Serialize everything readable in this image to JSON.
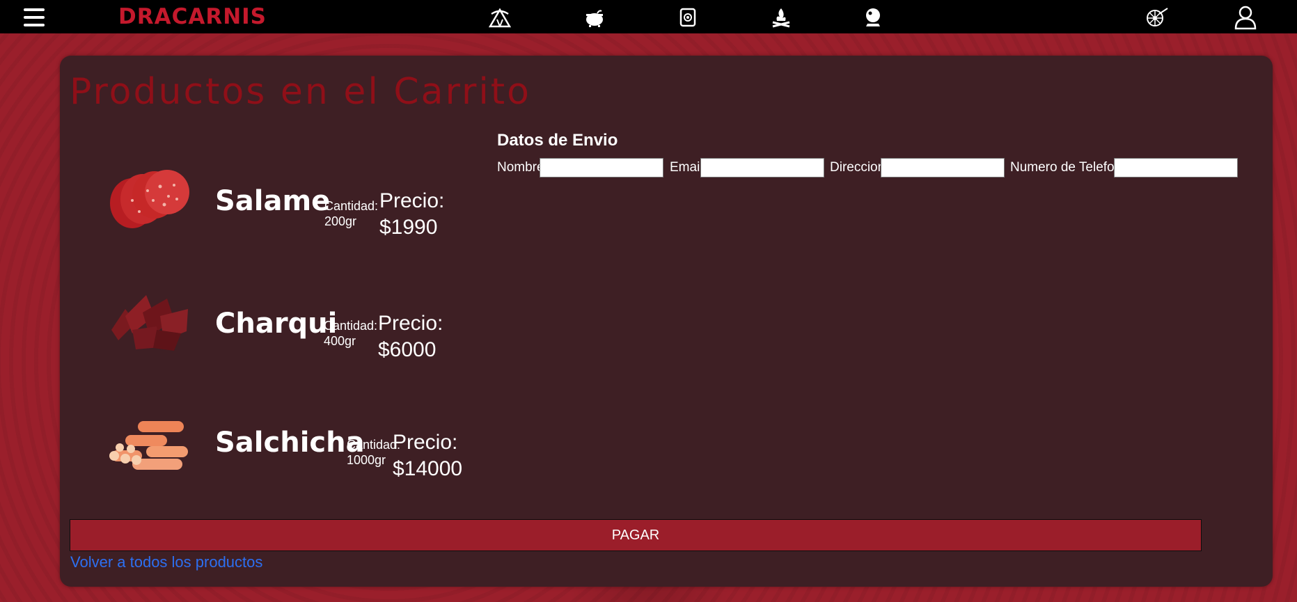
{
  "header": {
    "brand": "DRACARNIS",
    "nav_icons": [
      "tent-icon",
      "cauldron-icon",
      "sack-icon",
      "campfire-icon",
      "crystal-ball-icon",
      "cart-wheel-icon",
      "user-icon"
    ]
  },
  "main": {
    "title": "Productos en el Carrito",
    "products": [
      {
        "name": "Salame",
        "qty_label": "Cantidad:",
        "qty_value": "200gr",
        "price_label": "Precio:",
        "price_value": "$1990",
        "image": "salame-image"
      },
      {
        "name": "Charqui",
        "qty_label": "Cantidad:",
        "qty_value": "400gr",
        "price_label": "Precio:",
        "price_value": "$6000",
        "image": "charqui-image"
      },
      {
        "name": "Salchicha",
        "qty_label": "Cantidad:",
        "qty_value": "1000gr",
        "price_label": "Precio:",
        "price_value": "$14000",
        "image": "salchicha-image"
      }
    ],
    "shipping": {
      "title": "Datos de Envio",
      "fields": [
        {
          "label": "Nombre",
          "value": "",
          "placeholder": ""
        },
        {
          "label": "Email",
          "value": "",
          "placeholder": ""
        },
        {
          "label": "Direccion",
          "value": "",
          "placeholder": ""
        },
        {
          "label": "Numero de Telefono",
          "value": "",
          "placeholder": ""
        }
      ]
    },
    "pay_button": "PAGAR",
    "back_link": "Volver a todos los productos"
  },
  "colors": {
    "background": "#9a1f2b",
    "topbar": "#000000",
    "brand": "#c4192c",
    "panel": "#3e1f24",
    "title": "#8f0f18",
    "button": "#9b1e2a",
    "link": "#2d6ff0"
  }
}
